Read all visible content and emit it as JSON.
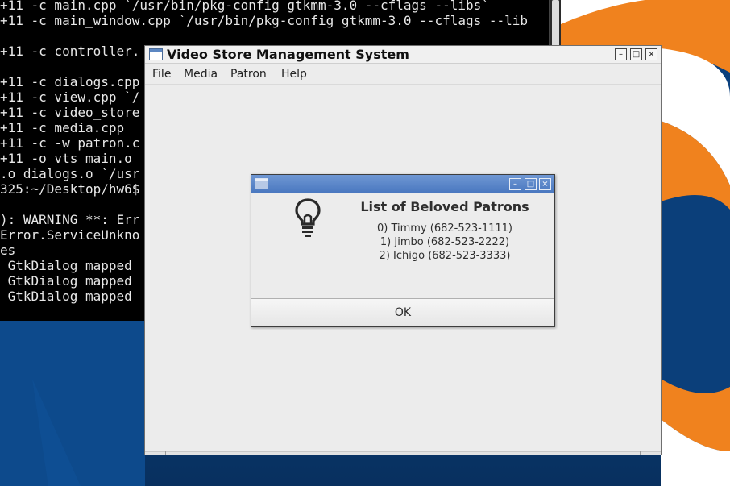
{
  "terminal": {
    "lines": [
      "+11 -c main.cpp `/usr/bin/pkg-config gtkmm-3.0 --cflags --libs`",
      "+11 -c main_window.cpp `/usr/bin/pkg-config gtkmm-3.0 --cflags --lib",
      "",
      "+11 -c controller.",
      "",
      "+11 -c dialogs.cpp",
      "+11 -c view.cpp `/",
      "+11 -c video_store",
      "+11 -c media.cpp",
      "+11 -c -w patron.c",
      "+11 -o vts main.o",
      ".o dialogs.o `/usr",
      "325:~/Desktop/hw6$",
      "",
      "): WARNING **: Err",
      "Error.ServiceUnkno",
      "es",
      " GtkDialog mapped",
      " GtkDialog mapped",
      " GtkDialog mapped"
    ]
  },
  "main_window": {
    "title": "Video Store Management System",
    "title_icon": "window-icon",
    "buttons": {
      "minimize": "–",
      "maximize": "□",
      "close": "×"
    },
    "menu": [
      "File",
      "Media",
      "Patron",
      "Help"
    ]
  },
  "dialog": {
    "icon": "lightbulb-icon",
    "buttons": {
      "minimize": "–",
      "maximize": "□",
      "close": "×"
    },
    "heading": "List of Beloved Patrons",
    "patrons": [
      "0) Timmy (682-523-1111)",
      "1) Jimbo (682-523-2222)",
      "2) Ichigo (682-523-3333)"
    ],
    "ok_label": "OK"
  },
  "colors": {
    "desktop_blue": "#0b3f7a",
    "accent_orange": "#f0821e",
    "dialog_titlebar": "#4a78c0"
  }
}
